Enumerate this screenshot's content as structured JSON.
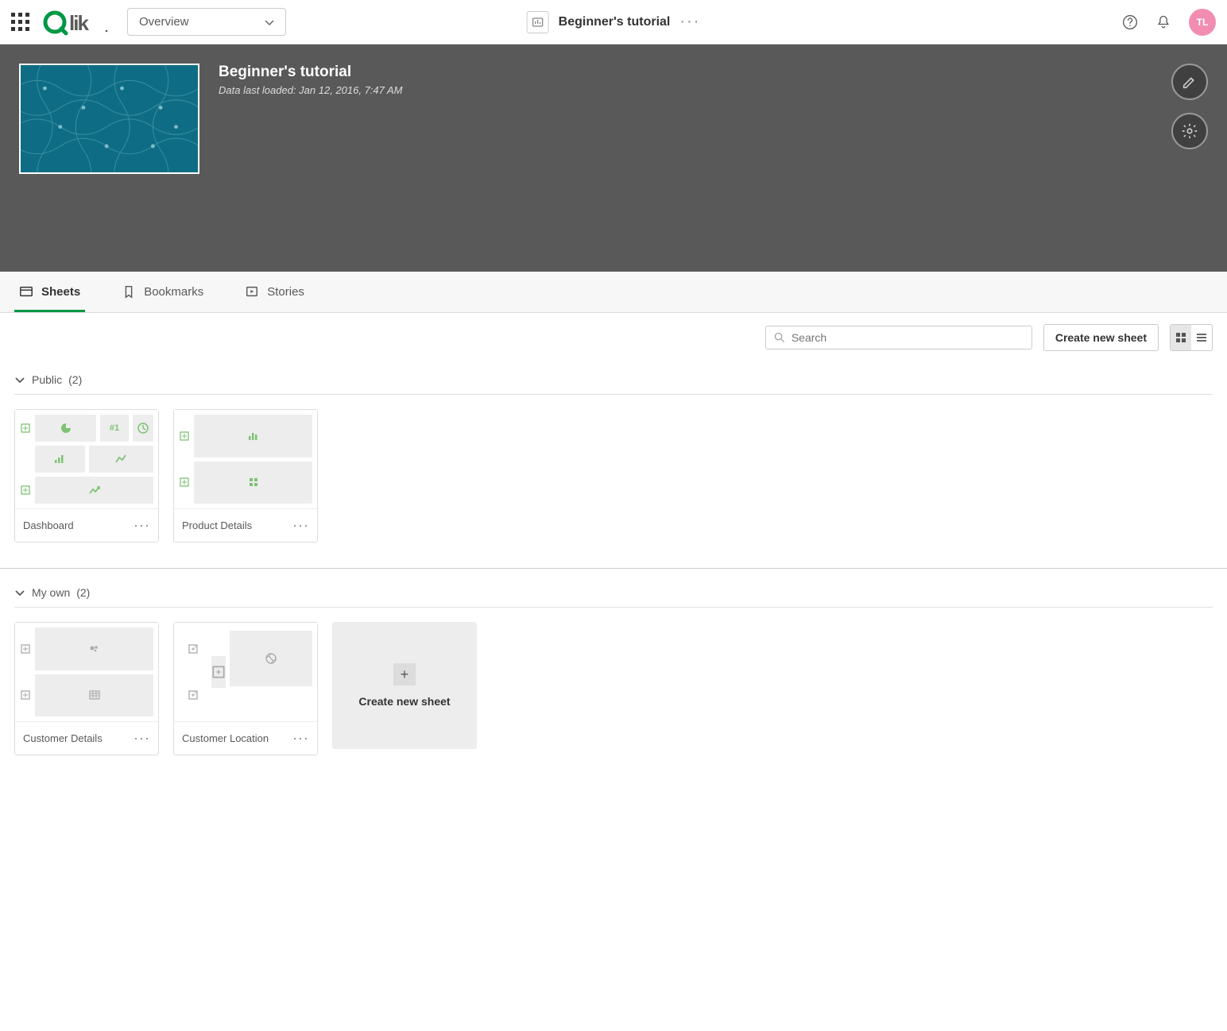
{
  "header": {
    "dropdown_label": "Overview",
    "app_title": "Beginner's tutorial",
    "avatar_initials": "TL"
  },
  "hero": {
    "title": "Beginner's tutorial",
    "subtitle": "Data last loaded: Jan 12, 2016, 7:47 AM"
  },
  "tabs": {
    "sheets": "Sheets",
    "bookmarks": "Bookmarks",
    "stories": "Stories"
  },
  "toolbar": {
    "search_placeholder": "Search",
    "create_label": "Create new sheet"
  },
  "sections": {
    "public": {
      "label": "Public",
      "count": "(2)"
    },
    "myown": {
      "label": "My own",
      "count": "(2)"
    }
  },
  "cards": {
    "dashboard": "Dashboard",
    "product_details": "Product Details",
    "customer_details": "Customer Details",
    "customer_location": "Customer Location",
    "create_new": "Create new sheet",
    "hash1": "#1"
  }
}
